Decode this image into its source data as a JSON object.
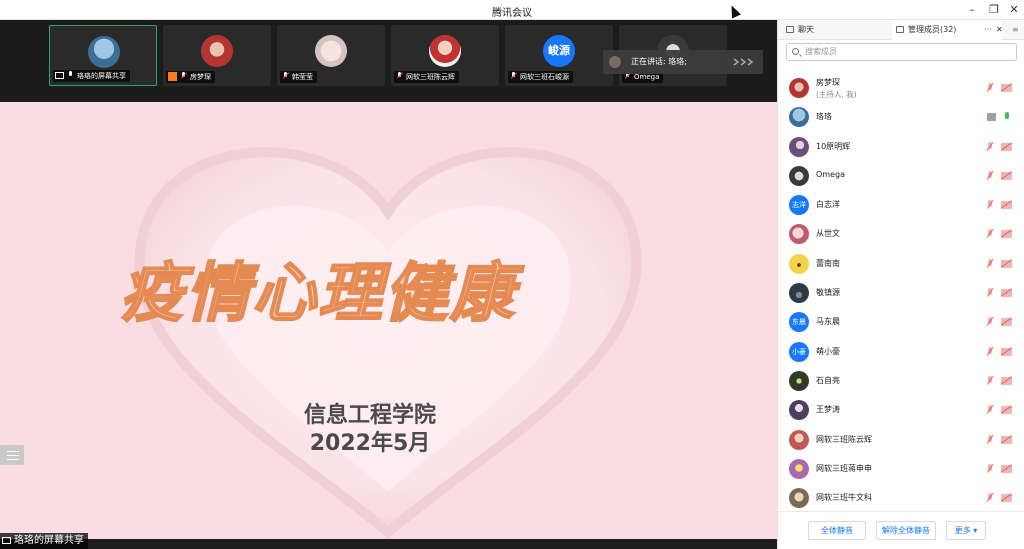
{
  "window": {
    "title": "腾讯会议",
    "controls": [
      "minimize",
      "restore",
      "close"
    ]
  },
  "video_strip": {
    "tiles": [
      {
        "name": "珞珞的屏幕共享",
        "avatar": "ocean-photo",
        "mic": "on",
        "sharing": true,
        "active": true
      },
      {
        "name": "房梦琛",
        "avatar": "red-photo",
        "mic": "muted",
        "host": true
      },
      {
        "name": "韩莹莹",
        "avatar": "pig-photo",
        "mic": "muted"
      },
      {
        "name": "网软三班陈云辉",
        "avatar": "child-photo",
        "mic": "muted"
      },
      {
        "name": "网软三班石峻源",
        "avatar_text": "峻源",
        "mic": "muted"
      },
      {
        "name": "Omega",
        "avatar": "dark-photo",
        "mic": "muted"
      }
    ],
    "speaking": "正在讲话: 珞珞;"
  },
  "slide": {
    "title": "疫情心理健康",
    "subtitle_line1": "信息工程学院",
    "subtitle_line2": "2022年5月",
    "share_label": "珞珞的屏幕共享"
  },
  "panel": {
    "tab_chat": "聊天",
    "tab_members": "管理成员(32)",
    "more": "···",
    "close": "✕",
    "menu": "≡",
    "search_placeholder": "搜索成员",
    "members": [
      {
        "name": "房梦琛",
        "sub": "(主持人, 我)",
        "avatar_color": "#b04040",
        "mic": "muted",
        "cam": "off"
      },
      {
        "name": "珞珞",
        "avatar_color": "#4b7fa3",
        "mic": "on",
        "cam": "screen"
      },
      {
        "name": "10原明辉",
        "avatar_color": "#6b4f7a",
        "mic": "muted",
        "cam": "off"
      },
      {
        "name": "Omega",
        "avatar_color": "#3a3a3a",
        "mic": "muted",
        "cam": "off"
      },
      {
        "name": "白志洋",
        "avatar_text": "志洋",
        "avatar_color": "#1677ff",
        "mic": "muted",
        "cam": "off"
      },
      {
        "name": "从世文",
        "avatar_color": "#c05b6b",
        "mic": "muted",
        "cam": "off"
      },
      {
        "name": "蕾南南",
        "avatar_color": "#f2d34a",
        "mic": "muted",
        "cam": "off"
      },
      {
        "name": "敬镇源",
        "avatar_color": "#2e3a45",
        "mic": "muted",
        "cam": "off"
      },
      {
        "name": "马东晨",
        "avatar_text": "东晨",
        "avatar_color": "#1677ff",
        "mic": "muted",
        "cam": "off"
      },
      {
        "name": "萌小豪",
        "avatar_text": "小豪",
        "avatar_color": "#1677ff",
        "mic": "muted",
        "cam": "off"
      },
      {
        "name": "石自亮",
        "avatar_color": "#2f3b28",
        "mic": "muted",
        "cam": "off"
      },
      {
        "name": "王梦涛",
        "avatar_color": "#4a3f5e",
        "mic": "muted",
        "cam": "off"
      },
      {
        "name": "网软三班陈云辉",
        "avatar_color": "#c0585a",
        "mic": "muted",
        "cam": "off"
      },
      {
        "name": "网软三班蒋申申",
        "avatar_color": "#a868b0",
        "mic": "muted",
        "cam": "off"
      },
      {
        "name": "网软三班牛文科",
        "avatar_color": "#7a6a55",
        "mic": "muted",
        "cam": "off"
      }
    ],
    "footer": {
      "mute_all": "全体静音",
      "unmute_all": "解除全体静音",
      "more": "更多 ▾"
    }
  }
}
